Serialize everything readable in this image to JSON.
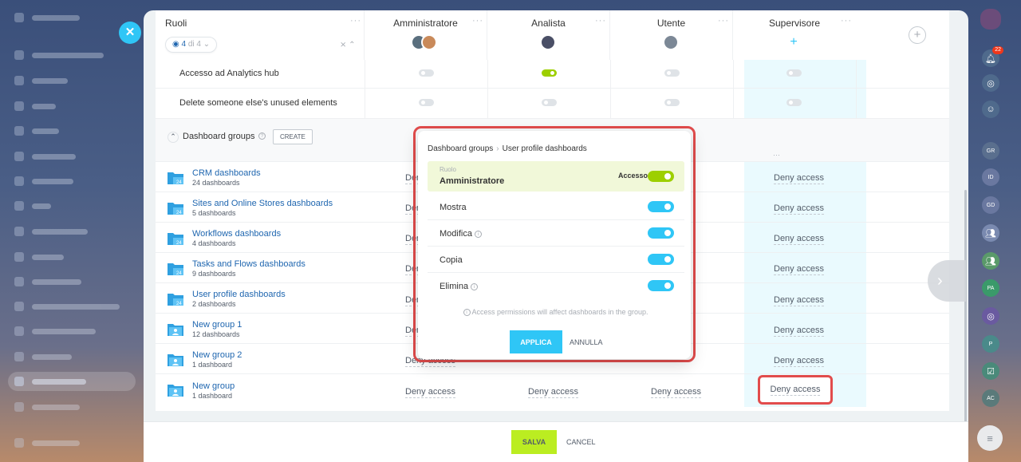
{
  "header": {
    "roles_title": "Ruoli",
    "role_counter": "4",
    "role_counter_suffix": "di 4",
    "columns": [
      {
        "title": "Amministratore"
      },
      {
        "title": "Analista"
      },
      {
        "title": "Utente"
      },
      {
        "title": "Supervisore"
      }
    ],
    "add_role_icon": "plus-icon"
  },
  "permission_rows": [
    {
      "label": "Accesso ad Analytics hub",
      "values": [
        false,
        true,
        false,
        false
      ]
    },
    {
      "label": "Delete someone else's unused elements",
      "values": [
        false,
        false,
        false,
        false
      ]
    }
  ],
  "section": {
    "title": "Dashboard groups",
    "create_label": "CREATE"
  },
  "groups": [
    {
      "name": "CRM dashboards",
      "count": "24 dashboards",
      "icon": "folder-24-icon",
      "cells": [
        "Deny access",
        "",
        "",
        "Deny access"
      ]
    },
    {
      "name": "Sites and Online Stores dashboards",
      "count": "5 dashboards",
      "icon": "folder-24-icon",
      "cells": [
        "Deny access",
        "",
        "",
        "Deny access"
      ]
    },
    {
      "name": "Workflows dashboards",
      "count": "4 dashboards",
      "icon": "folder-24-icon",
      "cells": [
        "Deny access",
        "",
        "",
        "Deny access"
      ]
    },
    {
      "name": "Tasks and Flows dashboards",
      "count": "9 dashboards",
      "icon": "folder-24-icon",
      "cells": [
        "Deny access",
        "",
        "",
        "Deny access"
      ]
    },
    {
      "name": "User profile dashboards",
      "count": "2 dashboards",
      "icon": "folder-24-icon",
      "cells": [
        "Deny access",
        "",
        "",
        "Deny access"
      ]
    },
    {
      "name": "New group 1",
      "count": "12 dashboards",
      "icon": "folder-user-icon",
      "cells": [
        "Deny access",
        "",
        "",
        "Deny access"
      ]
    },
    {
      "name": "New group 2",
      "count": "1 dashboard",
      "icon": "folder-user-icon",
      "cells": [
        "Deny access",
        "",
        "",
        "Deny access"
      ]
    },
    {
      "name": "New group",
      "count": "1 dashboard",
      "icon": "folder-user-icon",
      "cells": [
        "Deny access",
        "Deny access",
        "Deny access",
        "Deny access"
      ]
    }
  ],
  "popup": {
    "breadcrumb_parent": "Dashboard groups",
    "breadcrumb_child": "User profile dashboards",
    "role_caption": "Ruolo",
    "role_name": "Amministratore",
    "access_label": "Accesso",
    "access_on": true,
    "permissions": [
      {
        "label": "Mostra",
        "info": false,
        "on": true
      },
      {
        "label": "Modifica",
        "info": true,
        "on": true
      },
      {
        "label": "Copia",
        "info": false,
        "on": true
      },
      {
        "label": "Elimina",
        "info": true,
        "on": true
      }
    ],
    "note": "Access permissions will affect dashboards in the group.",
    "apply_label": "APPLICA",
    "cancel_label": "ANNULLA"
  },
  "footer": {
    "save_label": "SALVA",
    "cancel_label": "CANCEL"
  },
  "rightbar": {
    "notifications_badge": "22",
    "items": [
      "GR",
      "ID",
      "GD",
      "PA",
      "P",
      "AC"
    ]
  },
  "colors": {
    "accent_blue": "#2fc6f6",
    "accent_green": "#bbed21",
    "toggle_green": "#9dcf00",
    "highlight_red": "#e24c4c",
    "link_blue": "#2067b0"
  }
}
